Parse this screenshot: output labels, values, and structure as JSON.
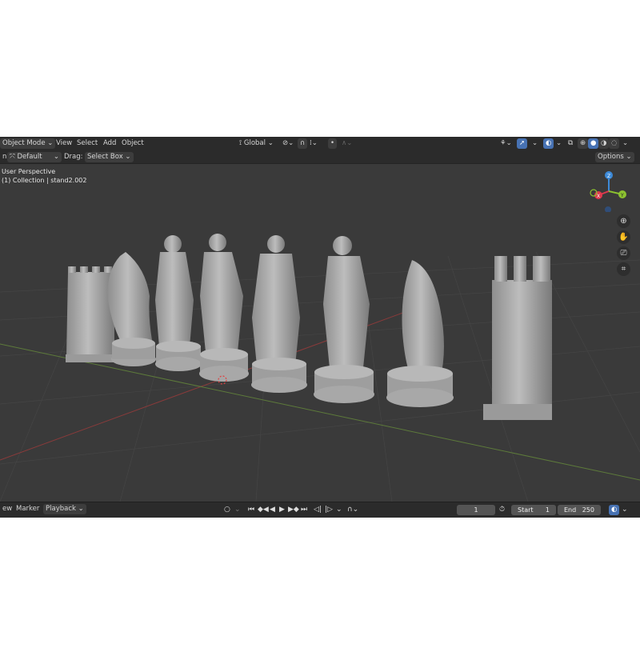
{
  "header": {
    "mode": "Object Mode",
    "menus": [
      "View",
      "Select",
      "Add",
      "Object"
    ],
    "transform_orientation": "Global"
  },
  "tool_header": {
    "orientation_label": "n:",
    "orientation_value": "Default",
    "drag_label": "Drag:",
    "drag_value": "Select Box",
    "options": "Options"
  },
  "viewport": {
    "view_name": "User Perspective",
    "collection_info": "(1) Collection | stand2.002",
    "axis_labels": {
      "z": "Z",
      "x": "X",
      "y": "Y"
    },
    "nav_icons": [
      "zoom-icon",
      "hand-pan-icon",
      "camera-icon",
      "ortho-grid-icon"
    ]
  },
  "timeline": {
    "menus": [
      "ew",
      "Marker",
      "Playback"
    ],
    "current_frame": "1",
    "start_label": "Start",
    "start_value": "1",
    "end_label": "End",
    "end_value": "250"
  },
  "colors": {
    "accent": "#4772b3",
    "axis_x": "#e0394d",
    "axis_y": "#8cc230",
    "axis_z": "#3d8ad8"
  }
}
